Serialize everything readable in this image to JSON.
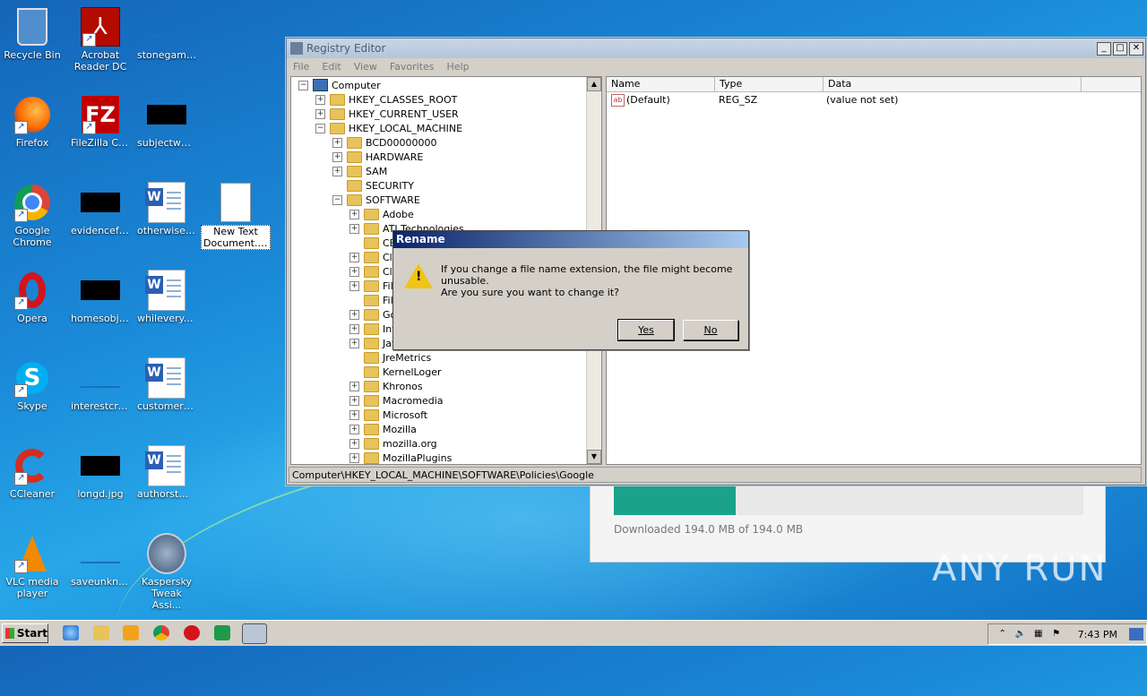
{
  "desktop": {
    "icons": [
      {
        "label": "Recycle Bin"
      },
      {
        "label": "Acrobat Reader DC"
      },
      {
        "label": "stonegame...."
      },
      {
        "label": "Firefox"
      },
      {
        "label": "FileZilla Client"
      },
      {
        "label": "subjectwor..."
      },
      {
        "label": "Google Chrome"
      },
      {
        "label": "evidencefuc..."
      },
      {
        "label": "otherwisewi..."
      },
      {
        "label": "New Text Document.reg"
      },
      {
        "label": "Opera"
      },
      {
        "label": "homesobje..."
      },
      {
        "label": "whilevery.rtf"
      },
      {
        "label": "Skype"
      },
      {
        "label": "interestcre..."
      },
      {
        "label": "customersu..."
      },
      {
        "label": "CCleaner"
      },
      {
        "label": "longd.jpg"
      },
      {
        "label": "authorstwo.rtf"
      },
      {
        "label": "VLC media player"
      },
      {
        "label": "saveunkno..."
      },
      {
        "label": "Kaspersky Tweak Assi..."
      }
    ]
  },
  "download": {
    "text": "Downloaded 194.0 MB of 194.0 MB",
    "progress": 1.0,
    "color": "#1aa28a"
  },
  "watermark": "ANY RUN",
  "registry": {
    "title": "Registry Editor",
    "menu": [
      "File",
      "Edit",
      "View",
      "Favorites",
      "Help"
    ],
    "tree": [
      {
        "label": "Computer"
      },
      {
        "label": "HKEY_CLASSES_ROOT"
      },
      {
        "label": "HKEY_CURRENT_USER"
      },
      {
        "label": "HKEY_LOCAL_MACHINE"
      },
      {
        "label": "BCD00000000"
      },
      {
        "label": "HARDWARE"
      },
      {
        "label": "SAM"
      },
      {
        "label": "SECURITY"
      },
      {
        "label": "SOFTWARE"
      },
      {
        "label": "Adobe"
      },
      {
        "label": "ATI Technologies"
      },
      {
        "label": "CB"
      },
      {
        "label": "Cla"
      },
      {
        "label": "Cli"
      },
      {
        "label": "File"
      },
      {
        "label": "File"
      },
      {
        "label": "Go"
      },
      {
        "label": "Int"
      },
      {
        "label": "Jav"
      },
      {
        "label": "JreMetrics"
      },
      {
        "label": "KernelLoger"
      },
      {
        "label": "Khronos"
      },
      {
        "label": "Macromedia"
      },
      {
        "label": "Microsoft"
      },
      {
        "label": "Mozilla"
      },
      {
        "label": "mozilla.org"
      },
      {
        "label": "MozillaPlugins"
      }
    ],
    "columns": [
      "Name",
      "Type",
      "Data"
    ],
    "values": [
      {
        "name": "(Default)",
        "type": "REG_SZ",
        "data": "(value not set)"
      }
    ],
    "status": "Computer\\HKEY_LOCAL_MACHINE\\SOFTWARE\\Policies\\Google"
  },
  "dialog": {
    "title": "Rename",
    "message": "If you change a file name extension, the file might become unusable.",
    "question": "Are you sure you want to change it?",
    "yes": "Yes",
    "no": "No"
  },
  "taskbar": {
    "start": "Start",
    "clock": "7:43 PM"
  }
}
